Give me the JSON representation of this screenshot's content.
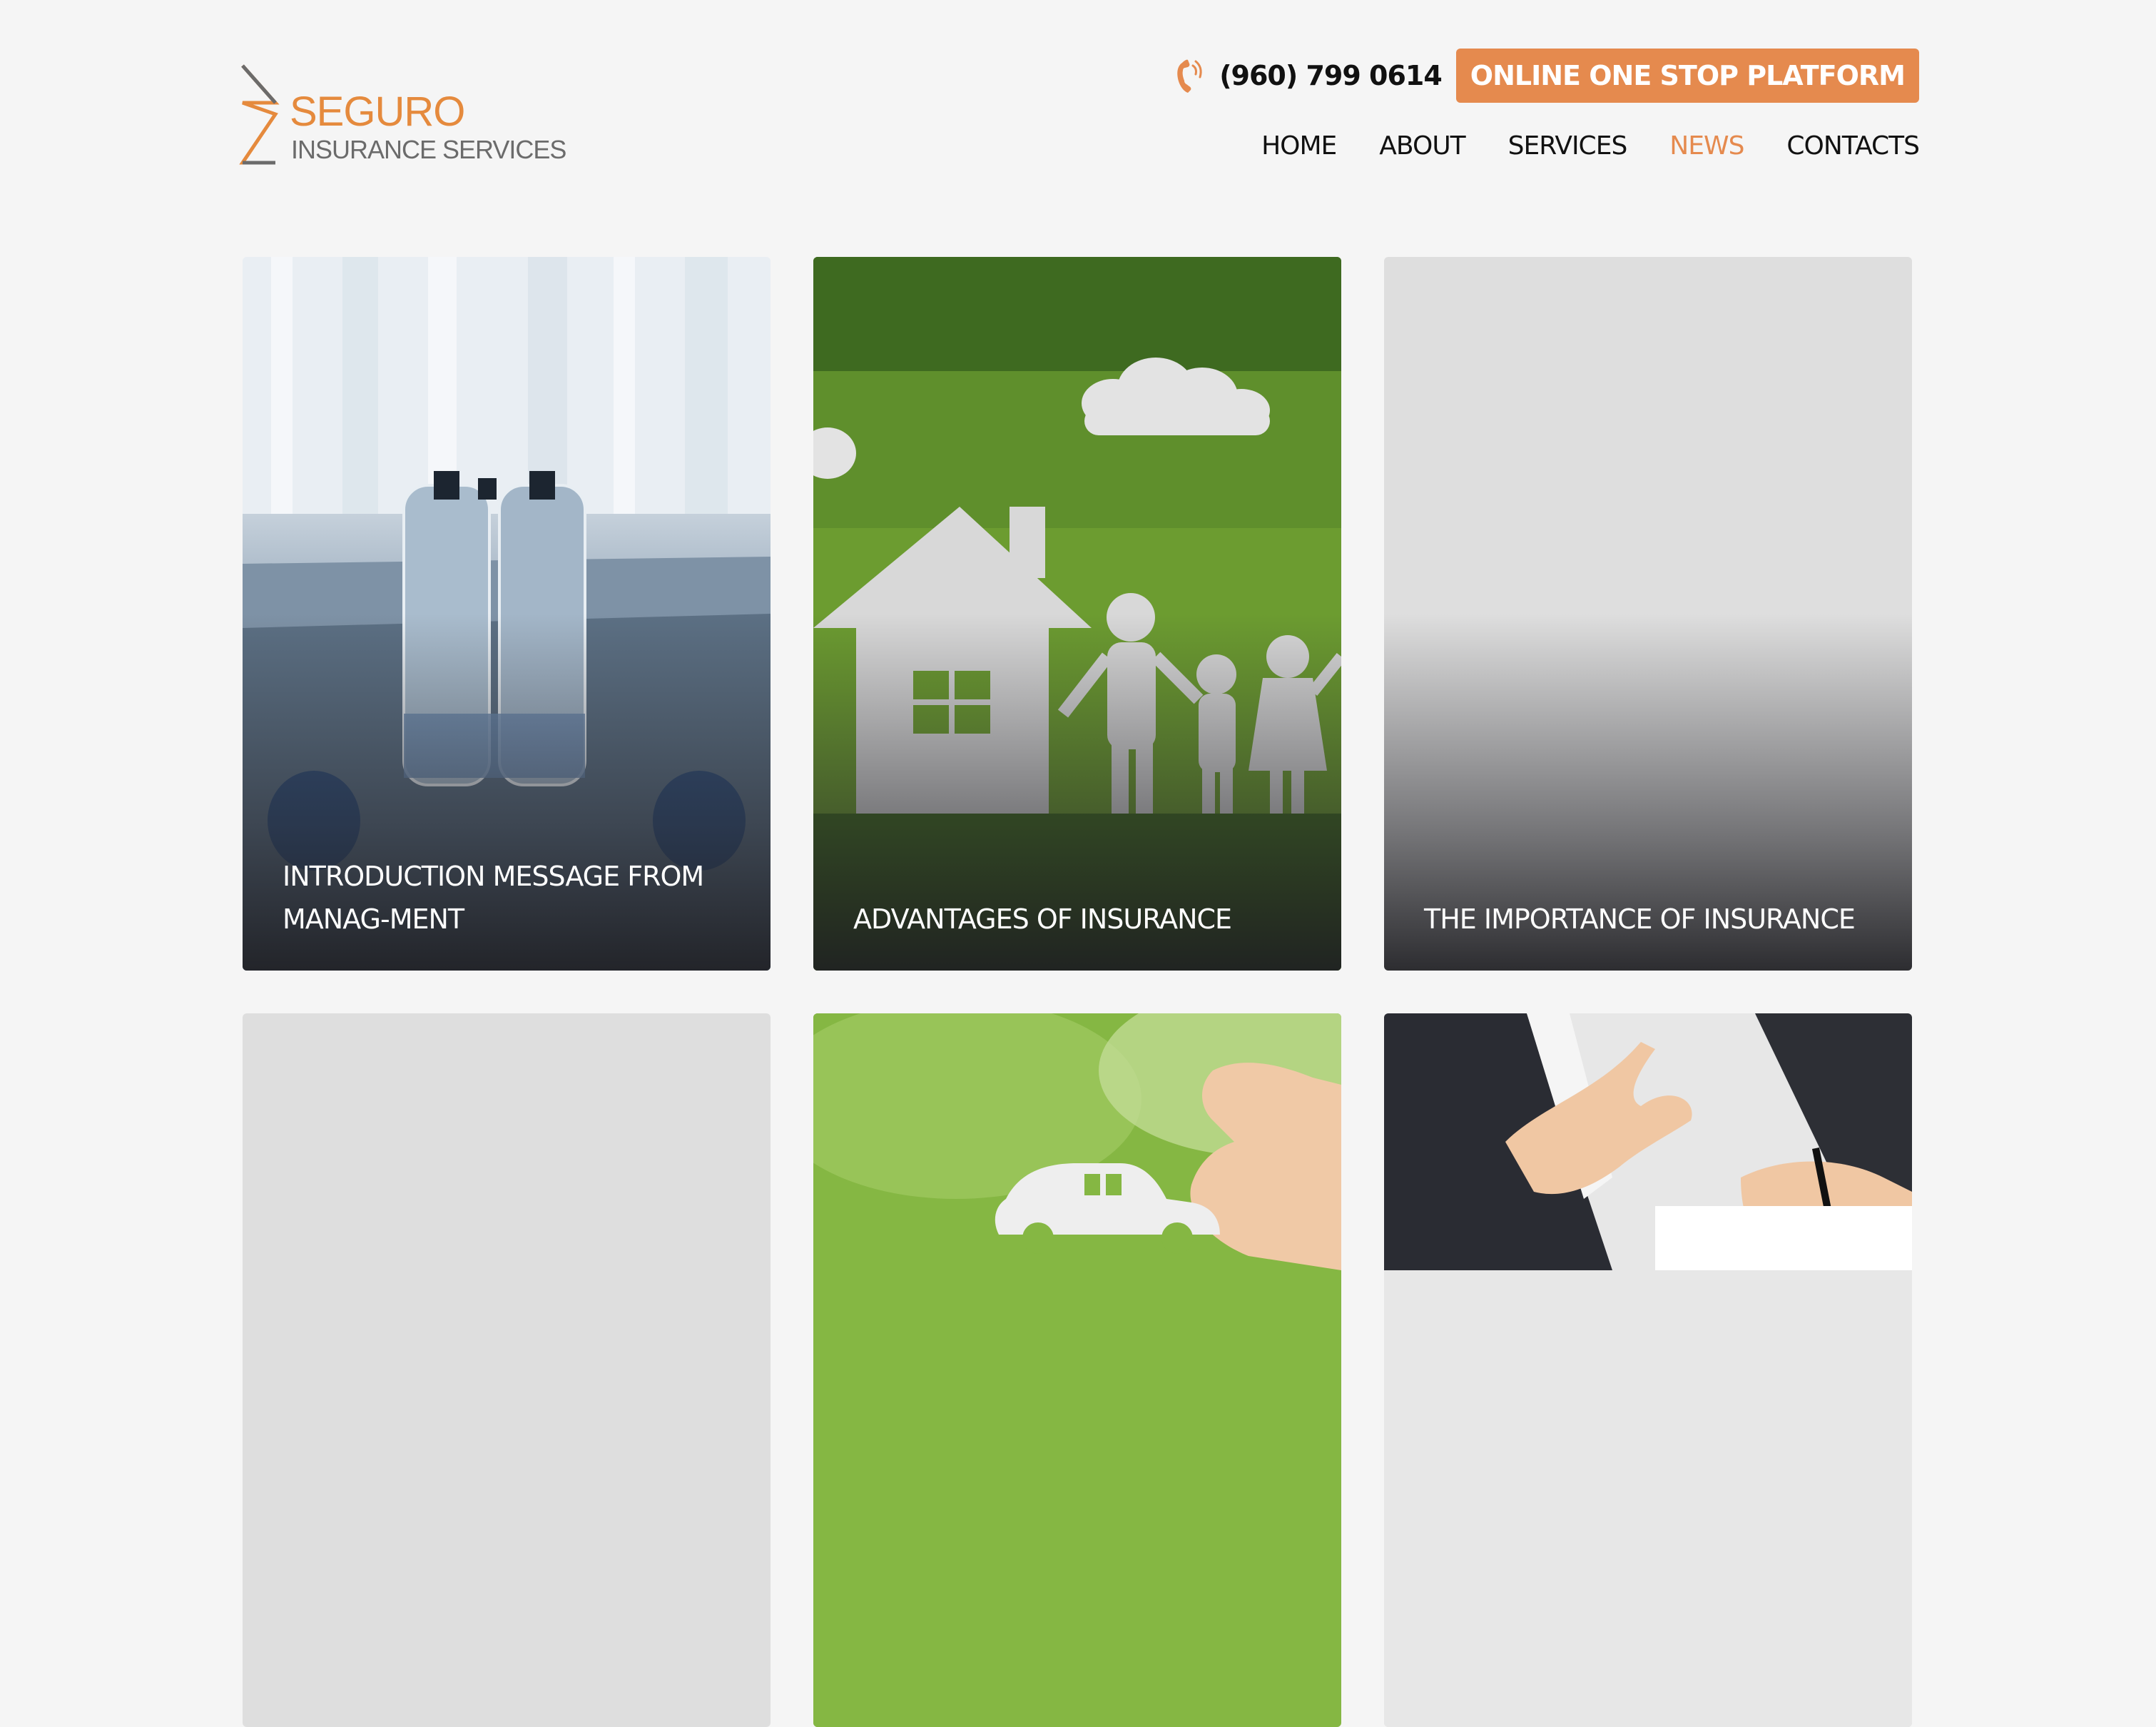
{
  "header": {
    "logo": {
      "brand": "SEGURO",
      "tagline": "INSURANCE SERVICES"
    },
    "phone": "(960) 799 0614",
    "cta_label": "ONLINE ONE STOP PLATFORM"
  },
  "nav": {
    "items": [
      {
        "label": "HOME"
      },
      {
        "label": "ABOUT"
      },
      {
        "label": "SERVICES"
      },
      {
        "label": "NEWS",
        "active": true
      },
      {
        "label": "CONTACTS"
      }
    ]
  },
  "news": {
    "cards": [
      {
        "title": "INTRODUCTION MESSAGE FROM MANAG-MENT",
        "image": "water-bottles-meeting-table"
      },
      {
        "title": "ADVANTAGES OF INSURANCE",
        "image": "paper-house-family-on-grass"
      },
      {
        "title": "THE IMPORTANCE OF INSURANCE",
        "image": "placeholder"
      },
      {
        "title": "",
        "image": "placeholder"
      },
      {
        "title": "",
        "image": "hand-holding-paper-car"
      },
      {
        "title": "",
        "image": "business-handshake-signing"
      }
    ]
  },
  "colors": {
    "accent": "#e58a4e",
    "background": "#f5f5f5",
    "text": "#111111"
  }
}
